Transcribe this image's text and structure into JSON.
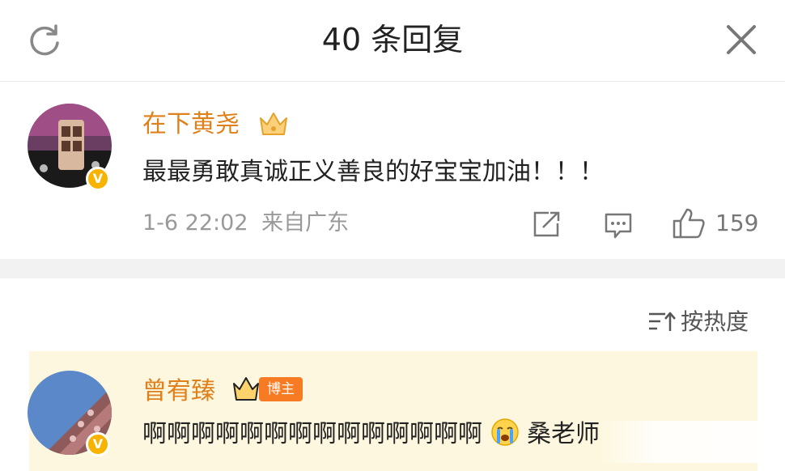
{
  "header": {
    "title": "40 条回复"
  },
  "main_comment": {
    "username": "在下黄尧",
    "text": "最最勇敢真诚正义善良的好宝宝加油！！！",
    "timestamp": "1-6 22:02",
    "location": "来自广东",
    "like_count": "159",
    "badge_icon": "crown-icon"
  },
  "sort": {
    "label": "按热度"
  },
  "reply": {
    "username": "曾宥臻",
    "tag": "博主",
    "text": "啊啊啊啊啊啊啊啊啊啊啊啊啊啊",
    "text_suffix": "桑老师",
    "emoji": "crying-face-icon"
  },
  "colors": {
    "username": "#e0801b",
    "highlight_bg": "#fdf7df",
    "blogger_tag": "#f77b23",
    "verified": "#f8b300"
  }
}
